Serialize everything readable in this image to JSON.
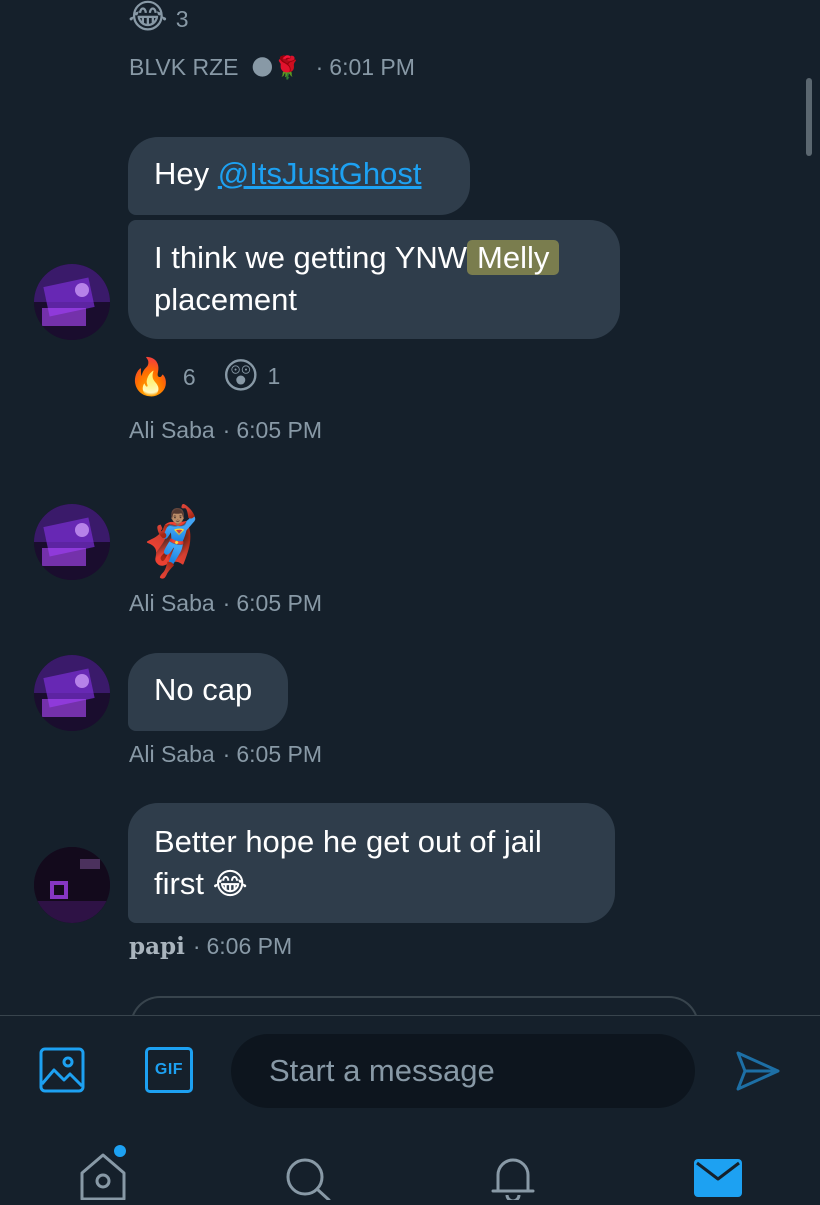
{
  "top_reaction": {
    "emoji": "😂",
    "count": "3"
  },
  "messages": [
    {
      "sender": "BLVK RZE",
      "sender_emojis": "🌑🌹",
      "time": "6:01 PM"
    },
    {
      "line1_prefix": "Hey ",
      "mention": "@ItsJustGhost",
      "line2_text": "I think we getting YNW",
      "line2_highlight": "Melly",
      "line3_text": "placement",
      "reactions": [
        {
          "emoji": "🔥",
          "count": "6"
        },
        {
          "emoji": "😲",
          "count": "1"
        }
      ],
      "sender": "Ali Saba",
      "time": "6:05 PM"
    },
    {
      "emoji": "🦸🏽‍♂️",
      "sender": "Ali Saba",
      "time": "6:05 PM"
    },
    {
      "text": "No cap",
      "sender": "Ali Saba",
      "time": "6:05 PM"
    },
    {
      "line1": "Better hope he get out of jail",
      "line2": "first ",
      "line2_emoji": "😂",
      "sender": "papi",
      "time": "6:06 PM"
    }
  ],
  "composer": {
    "placeholder": "Start a message",
    "gif_label": "GIF"
  },
  "colors": {
    "accent": "#1da1f2",
    "bubble": "#2f3d4b",
    "background": "#15202b",
    "meta": "#8899a6"
  }
}
